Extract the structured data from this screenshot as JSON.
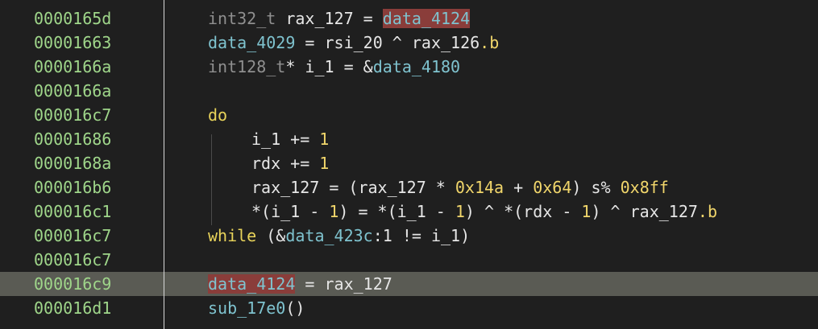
{
  "window": {
    "title": ""
  },
  "colors": {
    "background": "#1f1f1f",
    "address": "#9fd68a",
    "type": "#8f8f8f",
    "variable": "#e6e6e6",
    "data_symbol": "#7fc3cf",
    "number": "#f1d66b",
    "keyword": "#e8d35a",
    "selection": "#8a3d3a",
    "current_line": "#5a5b54"
  },
  "lines": [
    {
      "address": "0000165d",
      "tokens": [
        {
          "t": "int32_t ",
          "c": "type"
        },
        {
          "t": "rax_127",
          "c": "var"
        },
        {
          "t": " = ",
          "c": "op"
        },
        {
          "t": "data_4124",
          "c": "sel"
        }
      ]
    },
    {
      "address": "00001663",
      "tokens": [
        {
          "t": "data_4029",
          "c": "data"
        },
        {
          "t": " = ",
          "c": "op"
        },
        {
          "t": "rsi_20 ^ rax_126",
          "c": "var"
        },
        {
          "t": ".b",
          "c": "field"
        }
      ]
    },
    {
      "address": "0000166a",
      "tokens": [
        {
          "t": "int128_t",
          "c": "type"
        },
        {
          "t": "* i_1 = &",
          "c": "var"
        },
        {
          "t": "data_4180",
          "c": "data"
        }
      ]
    },
    {
      "address": "0000166a",
      "tokens": []
    },
    {
      "address": "000016c7",
      "tokens": [
        {
          "t": "do",
          "c": "kw"
        }
      ]
    },
    {
      "address": "00001686",
      "indent": true,
      "tokens": [
        {
          "t": "i_1 += ",
          "c": "var"
        },
        {
          "t": "1",
          "c": "num"
        }
      ]
    },
    {
      "address": "0000168a",
      "indent": true,
      "tokens": [
        {
          "t": "rdx += ",
          "c": "var"
        },
        {
          "t": "1",
          "c": "num"
        }
      ]
    },
    {
      "address": "000016b6",
      "indent": true,
      "tokens": [
        {
          "t": "rax_127 = (rax_127 * ",
          "c": "var"
        },
        {
          "t": "0x14a",
          "c": "num"
        },
        {
          "t": " + ",
          "c": "op"
        },
        {
          "t": "0x64",
          "c": "num"
        },
        {
          "t": ") s% ",
          "c": "var"
        },
        {
          "t": "0x8ff",
          "c": "num"
        }
      ]
    },
    {
      "address": "000016c1",
      "indent": true,
      "tokens": [
        {
          "t": "*(i_1 - ",
          "c": "var"
        },
        {
          "t": "1",
          "c": "num"
        },
        {
          "t": ") = *(i_1 - ",
          "c": "var"
        },
        {
          "t": "1",
          "c": "num"
        },
        {
          "t": ") ^ *(rdx - ",
          "c": "var"
        },
        {
          "t": "1",
          "c": "num"
        },
        {
          "t": ") ^ rax_127",
          "c": "var"
        },
        {
          "t": ".b",
          "c": "field"
        }
      ]
    },
    {
      "address": "000016c7",
      "tokens": [
        {
          "t": "while",
          "c": "kw"
        },
        {
          "t": " (&",
          "c": "var"
        },
        {
          "t": "data_423c",
          "c": "data"
        },
        {
          "t": ":1 != i_1)",
          "c": "var"
        }
      ]
    },
    {
      "address": "000016c7",
      "tokens": []
    },
    {
      "address": "000016c9",
      "highlighted": true,
      "tokens": [
        {
          "t": "data_4124",
          "c": "sel"
        },
        {
          "t": " = rax_127",
          "c": "var"
        }
      ]
    },
    {
      "address": "000016d1",
      "tokens": [
        {
          "t": "sub_17e0",
          "c": "data"
        },
        {
          "t": "()",
          "c": "var"
        }
      ]
    }
  ]
}
